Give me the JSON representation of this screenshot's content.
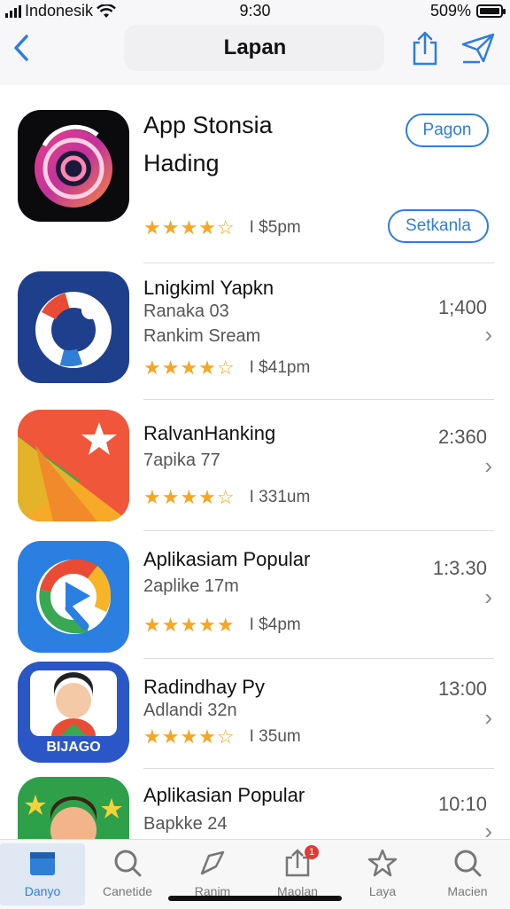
{
  "status": {
    "carrier": "Indonesik",
    "time": "9:30",
    "battery": "509%"
  },
  "nav": {
    "title": "Lapan"
  },
  "featured": {
    "name_line1": "App Stonsia",
    "name_line2": "Hading",
    "stars": "★★★★☆",
    "meta": "I $5pm",
    "button_top": "Pagon",
    "button_bottom": "Setkanla"
  },
  "apps": [
    {
      "name": "Lnigkiml Yapkn",
      "sub": "Ranaka 03",
      "sub2": "Rankim Sream",
      "count": "1;400",
      "stars": "★★★★☆",
      "meta": "I $41pm"
    },
    {
      "name": "RalvanHanking",
      "sub": "7apika 77",
      "sub2": "",
      "count": "2:360",
      "stars": "★★★★☆",
      "meta": "I 331um"
    },
    {
      "name": "Aplikasiam Popular",
      "sub": "2aplike 17m",
      "sub2": "",
      "count": "1:3.30",
      "stars": "★★★★★",
      "meta": "I $4pm"
    },
    {
      "name": "Radindhay Py",
      "sub": "Adlandi 32n",
      "sub2": "",
      "count": "13:00",
      "stars": "★★★★☆",
      "meta": "I 35um"
    },
    {
      "name": "Aplikasian Popular",
      "sub": "Bapkke 24",
      "sub2": "",
      "count": "10:10",
      "stars": "",
      "meta": ""
    }
  ],
  "icon5_text": "BIJAGO",
  "tabs": [
    {
      "label": "Danyo",
      "icon": "today-icon"
    },
    {
      "label": "Canetide",
      "icon": "search-icon"
    },
    {
      "label": "Ranim",
      "icon": "ranking-icon"
    },
    {
      "label": "Maolan",
      "icon": "updates-icon"
    },
    {
      "label": "Laya",
      "icon": "star-icon"
    },
    {
      "label": "Macien",
      "icon": "search-icon"
    }
  ],
  "tab_badge": "1",
  "colors": {
    "accent": "#2f7ed8",
    "star": "#f5a623"
  }
}
